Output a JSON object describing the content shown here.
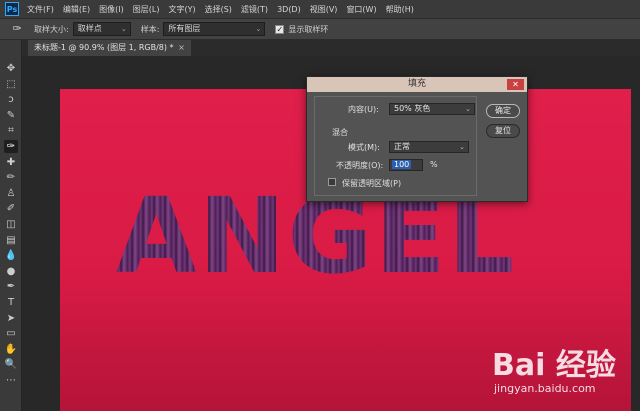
{
  "app": {
    "logo": "Ps"
  },
  "menubar": {
    "items": [
      "文件(F)",
      "编辑(E)",
      "图像(I)",
      "图层(L)",
      "文字(Y)",
      "选择(S)",
      "滤镜(T)",
      "3D(D)",
      "视图(V)",
      "窗口(W)",
      "帮助(H)"
    ]
  },
  "options": {
    "tool_icon": "eyedropper-icon",
    "sample_size_label": "取样大小:",
    "sample_size_value": "取样点",
    "sample_label": "样本:",
    "sample_value": "所有图层",
    "show_ring_label": "显示取样环",
    "show_ring_checked": true
  },
  "document": {
    "tab_title": "未标题-1 @ 90.9% (图层 1, RGB/8) *",
    "close": "×",
    "canvas_text": "ANGEL",
    "canvas_color": "#e01f4b"
  },
  "toolbar": {
    "tools": [
      {
        "name": "move-tool",
        "glyph": "✥"
      },
      {
        "name": "marquee-tool",
        "glyph": "⬚"
      },
      {
        "name": "lasso-tool",
        "glyph": "ↄ"
      },
      {
        "name": "quick-select-tool",
        "glyph": "✎"
      },
      {
        "name": "crop-tool",
        "glyph": "⌗"
      },
      {
        "name": "eyedropper-tool",
        "glyph": "✑",
        "active": true
      },
      {
        "name": "healing-tool",
        "glyph": "✚"
      },
      {
        "name": "brush-tool",
        "glyph": "✏"
      },
      {
        "name": "stamp-tool",
        "glyph": "♙"
      },
      {
        "name": "history-brush-tool",
        "glyph": "✐"
      },
      {
        "name": "eraser-tool",
        "glyph": "◫"
      },
      {
        "name": "gradient-tool",
        "glyph": "▤"
      },
      {
        "name": "blur-tool",
        "glyph": "💧"
      },
      {
        "name": "dodge-tool",
        "glyph": "●"
      },
      {
        "name": "pen-tool",
        "glyph": "✒"
      },
      {
        "name": "type-tool",
        "glyph": "T"
      },
      {
        "name": "path-select-tool",
        "glyph": "➤"
      },
      {
        "name": "shape-tool",
        "glyph": "▭"
      },
      {
        "name": "hand-tool",
        "glyph": "✋"
      },
      {
        "name": "zoom-tool",
        "glyph": "🔍"
      },
      {
        "name": "more-tools",
        "glyph": "⋯"
      }
    ]
  },
  "dialog": {
    "title": "填充",
    "close": "✕",
    "content_label": "内容(U):",
    "content_value": "50% 灰色",
    "blend_group": "混合",
    "mode_label": "模式(M):",
    "mode_value": "正常",
    "opacity_label": "不透明度(O):",
    "opacity_value": "100",
    "opacity_unit": "%",
    "preserve_label": "保留透明区域(P)",
    "preserve_checked": false,
    "ok_label": "确定",
    "reset_label": "复位"
  },
  "watermark": {
    "brand": "Bai 经验",
    "url": "jingyan.baidu.com"
  }
}
